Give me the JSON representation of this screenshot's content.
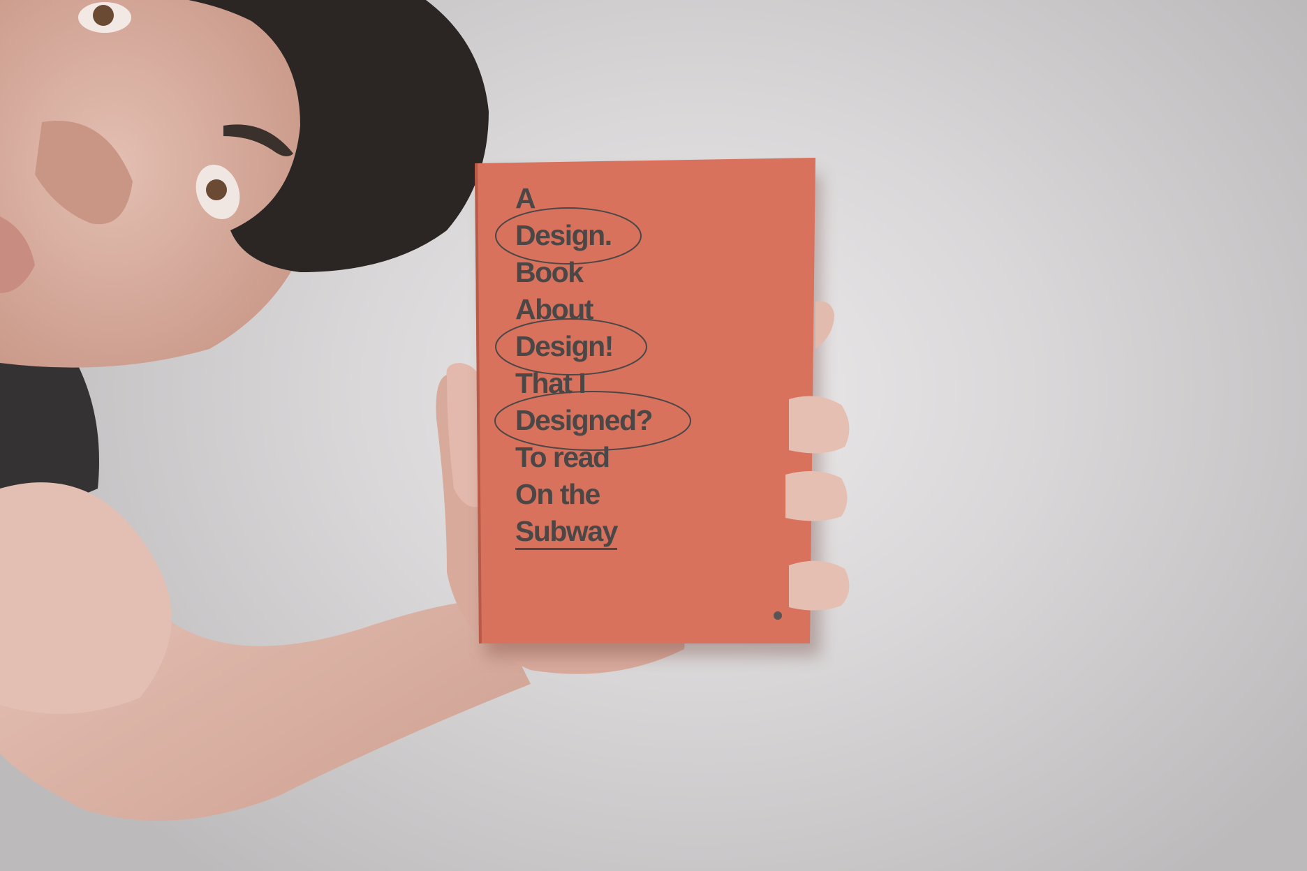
{
  "book_cover": {
    "color": "#d8725d",
    "text_color": "#4b4747",
    "lines": [
      {
        "text": "A",
        "circled": false,
        "underlined": false
      },
      {
        "text": "Design.",
        "circled": true,
        "underlined": false
      },
      {
        "text": "Book",
        "circled": false,
        "underlined": false
      },
      {
        "text": "About",
        "circled": false,
        "underlined": false
      },
      {
        "text": "Design!",
        "circled": true,
        "underlined": false
      },
      {
        "text": "That I",
        "circled": false,
        "underlined": false
      },
      {
        "text": "Designed?",
        "circled": true,
        "underlined": false
      },
      {
        "text": "To read",
        "circled": false,
        "underlined": false
      },
      {
        "text": "On the",
        "circled": false,
        "underlined": false
      },
      {
        "text": "Subway",
        "circled": false,
        "underlined": true
      }
    ]
  },
  "scene": {
    "background_color": "#d9d7d8",
    "skin_color": "#dcb2a4",
    "hair_color": "#2b2624",
    "shirt_color": "#353233"
  }
}
